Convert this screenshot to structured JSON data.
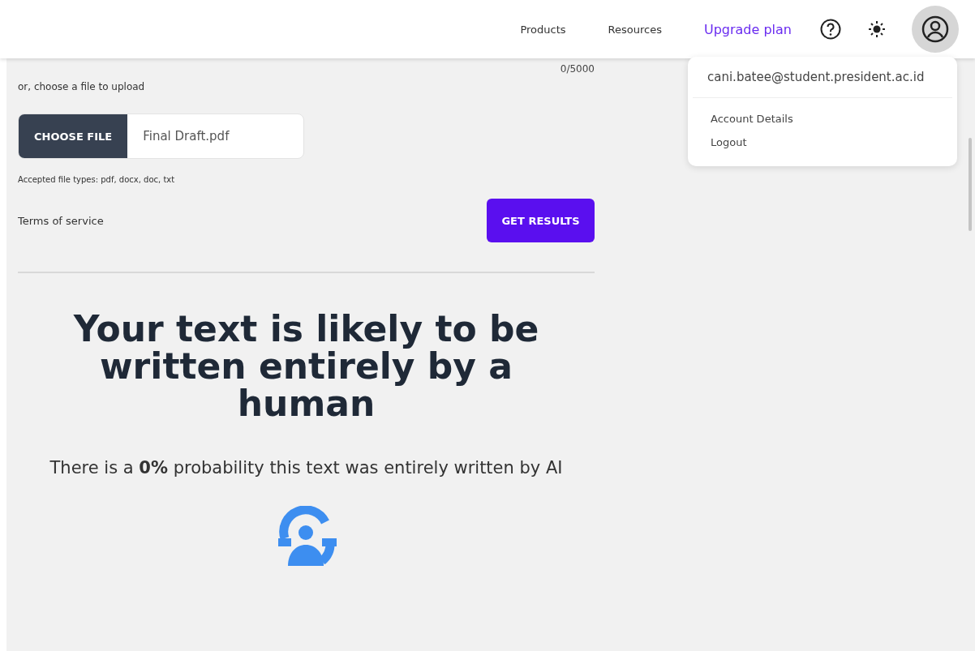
{
  "nav": {
    "links": [
      "Products",
      "Resources"
    ],
    "upgrade": "Upgrade plan"
  },
  "counter": "0/5000",
  "upload": {
    "hint": "or, choose a file to upload",
    "button": "CHOOSE FILE",
    "value": "Final Draft.pdf",
    "accepted": "Accepted file types: pdf, docx, doc, txt"
  },
  "terms": "Terms of service",
  "submit": "GET RESULTS",
  "result": {
    "headline": "Your text is likely to be written entirely by a human",
    "summary": "There is a **0%** probability this text was entirely written by AI"
  },
  "menu": {
    "email": "cani.batee@student.president.ac.id",
    "items": [
      "Account Details",
      "Logout"
    ]
  }
}
